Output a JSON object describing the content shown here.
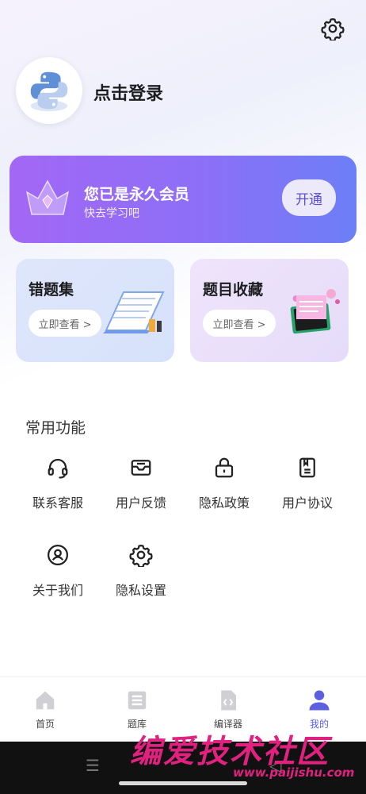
{
  "header": {
    "settings_icon": "gear-icon",
    "avatar_icon": "python-logo",
    "login_text": "点击登录"
  },
  "vip": {
    "title": "您已是永久会员",
    "subtitle": "快去学习吧",
    "button_label": "开通",
    "icon": "crown-icon"
  },
  "cards": [
    {
      "title": "错题集",
      "button_label": "立即查看 >"
    },
    {
      "title": "题目收藏",
      "button_label": "立即查看 >"
    }
  ],
  "functions": {
    "title": "常用功能",
    "items": [
      {
        "label": "联系客服",
        "icon": "headset-icon"
      },
      {
        "label": "用户反馈",
        "icon": "feedback-icon"
      },
      {
        "label": "隐私政策",
        "icon": "lock-icon"
      },
      {
        "label": "用户协议",
        "icon": "document-icon"
      },
      {
        "label": "关于我们",
        "icon": "user-circle-icon"
      },
      {
        "label": "隐私设置",
        "icon": "gear-icon"
      }
    ]
  },
  "tabbar": {
    "tabs": [
      {
        "label": "首页",
        "icon": "home-icon"
      },
      {
        "label": "题库",
        "icon": "list-icon"
      },
      {
        "label": "编译器",
        "icon": "code-file-icon"
      },
      {
        "label": "我的",
        "icon": "person-icon",
        "active": true
      }
    ]
  },
  "watermark": {
    "text": "编爱技术社区",
    "url": "www.paijishu.com"
  },
  "colors": {
    "accent": "#5b5fe0",
    "vip_gradient_start": "#a267f5",
    "vip_gradient_end": "#6c7ff6"
  }
}
